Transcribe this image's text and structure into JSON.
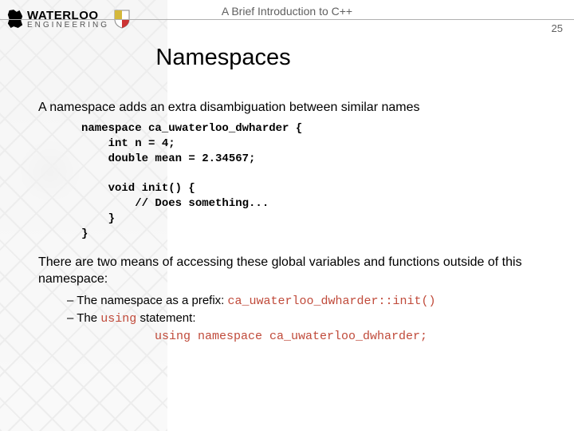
{
  "header": {
    "logo_top": "WATERLOO",
    "logo_bottom": "ENGINEERING",
    "doc_title": "A Brief Introduction to C++",
    "page_number": "25"
  },
  "slide": {
    "title": "Namespaces",
    "intro": "A namespace adds an extra disambiguation between similar names",
    "code": "namespace ca_uwaterloo_dwharder {\n    int n = 4;\n    double mean = 2.34567;\n\n    void init() {\n        // Does something...\n    }\n}",
    "second_para": "There are two means of accessing these global variables and functions outside of this namespace:",
    "bullets": {
      "b1_text": "The namespace as a prefix:   ",
      "b1_code": "ca_uwaterloo_dwharder::init()",
      "b2_text": "The ",
      "b2_code_inline": "using",
      "b2_text_after": " statement:",
      "b2_code_block": "using namespace ca_uwaterloo_dwharder;"
    }
  }
}
